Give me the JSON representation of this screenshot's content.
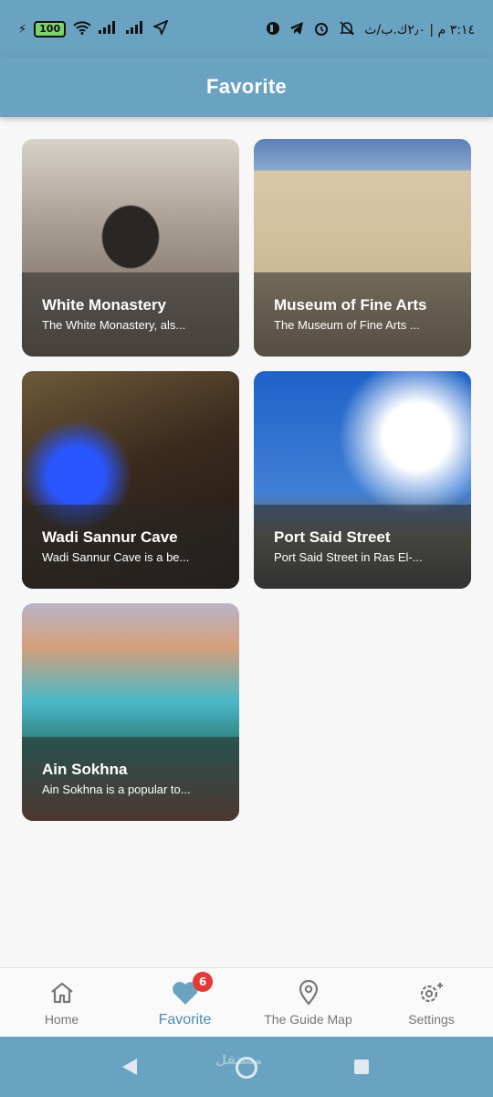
{
  "status_bar": {
    "battery": "100",
    "time_text": "٣:١٤ م | ٢٫٠ك.ب/ث"
  },
  "app_bar": {
    "title": "Favorite"
  },
  "favorites": [
    {
      "title": "White Monastery",
      "description": "The White Monastery, als..."
    },
    {
      "title": "Museum of Fine Arts",
      "description": "The Museum of Fine Arts ..."
    },
    {
      "title": "Wadi Sannur Cave",
      "description": "Wadi Sannur Cave is a be..."
    },
    {
      "title": "Port Said Street",
      "description": "Port Said Street in Ras El-..."
    },
    {
      "title": "Ain Sokhna",
      "description": "Ain Sokhna is a popular to..."
    }
  ],
  "bottom_nav": {
    "items": [
      {
        "label": "Home",
        "icon": "home-icon"
      },
      {
        "label": "Favorite",
        "icon": "heart-icon",
        "badge": "6",
        "active": true
      },
      {
        "label": "The Guide Map",
        "icon": "location-pin-icon"
      },
      {
        "label": "Settings",
        "icon": "settings-gear-icon"
      }
    ]
  },
  "watermark": "مستقل",
  "colors": {
    "primary": "#6aa3c2",
    "active": "#4f8cb0",
    "badge": "#e53935"
  }
}
